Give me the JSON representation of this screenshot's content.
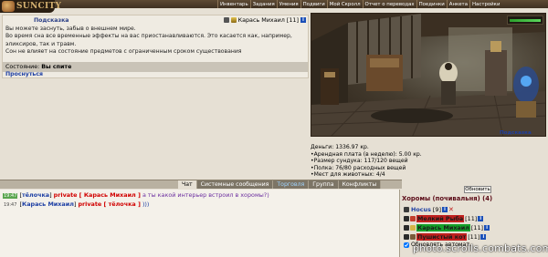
{
  "logo": {
    "text": "SUNCITY"
  },
  "menu": [
    "Инвентарь",
    "Задания",
    "Умения",
    "Подвиги",
    "Мой Скролл",
    "Отчет о переводах",
    "Поединки",
    "Анкета",
    "Настройки"
  ],
  "info_panel": {
    "title": "Подсказка",
    "user": "Карась Михаил",
    "level": "[11]",
    "lines": [
      "Вы можете заснуть, забыв о внешнем мире.",
      "Во время сна все временные эффекты на вас приостанавливаются. Это касается как, например,",
      "эликсиров, так и травм.",
      "Сон не влияет на состояние предметов с ограниченным сроком существования"
    ],
    "status_label": "Состояние:",
    "status_value": "Вы спите",
    "wake_link": "Проснуться"
  },
  "scene_hint_link": "Подсказка",
  "storage": {
    "money": "Деньги: 1336.97 кр.",
    "rent": "Арендная плата (в неделю): 5.00 кр.",
    "chest": "Размер сундука: 117/120 вещей",
    "shelf": "Полка: 76/80 расходных вещей",
    "pets": "Мест для животных: 4/4"
  },
  "chat_tabs": [
    "Чат",
    "Системные сообщения",
    "Торговля",
    "Группа",
    "Конфликты"
  ],
  "chat": [
    {
      "time": "19:47",
      "open": "[",
      "nick": "тёлочка",
      "close": "]",
      "private": "private [ Карась Михаил ]",
      "text": "а ты какой интерьер встроил в хоромы?)"
    },
    {
      "time": "19:47",
      "open": "[",
      "nick": "Карась Михаил",
      "close": "]",
      "private": "private [ тёлочка ]",
      "text": ")))"
    }
  ],
  "room": {
    "refresh_button": "Обновить",
    "title": "Хоромы (почивальня) (4)",
    "users": [
      {
        "name": "Hocus",
        "level": "[9]",
        "style": "plain"
      },
      {
        "name": "Мелкий Рыба",
        "level": "[11]",
        "style": "red"
      },
      {
        "name": "Карась Михаил",
        "level": "[11]",
        "style": "green"
      },
      {
        "name": "Пушистый кот",
        "level": "[11]",
        "style": "red"
      }
    ],
    "auto_refresh_label": "Обновлять автомат."
  },
  "watermark": "photo.scrolls.combats.com"
}
